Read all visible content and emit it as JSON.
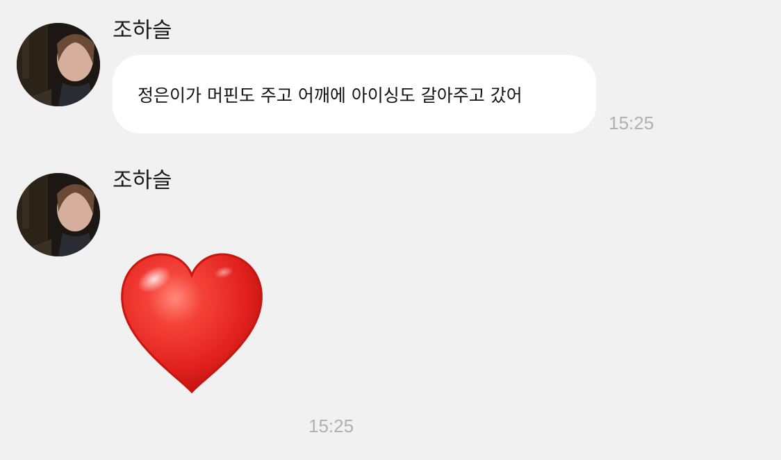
{
  "messages": [
    {
      "sender": "조하슬",
      "text": "정은이가 머핀도 주고 어깨에 아이싱도 갈아주고 갔어",
      "time": "15:25",
      "type": "text"
    },
    {
      "sender": "조하슬",
      "emoji": "red-heart",
      "time": "15:25",
      "type": "emoji"
    }
  ],
  "colors": {
    "background": "#f1f1f1",
    "bubble": "#ffffff",
    "timestamp": "#b0b0b0",
    "heart": "#e0201c"
  }
}
